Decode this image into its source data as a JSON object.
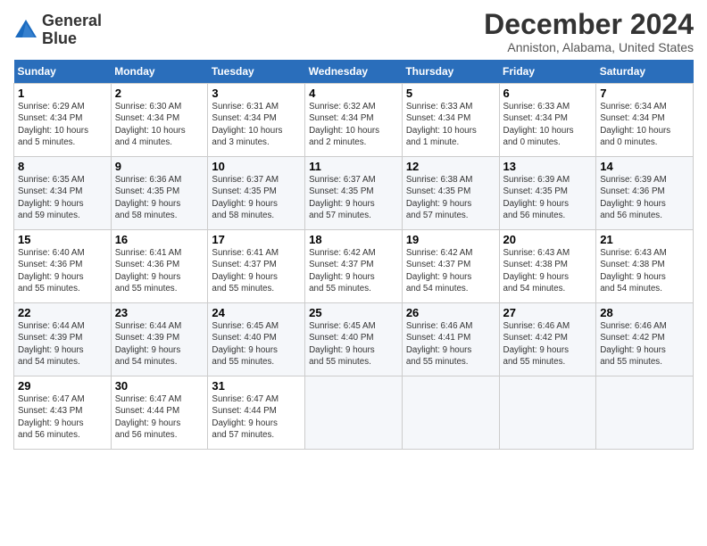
{
  "logo": {
    "line1": "General",
    "line2": "Blue"
  },
  "title": "December 2024",
  "subtitle": "Anniston, Alabama, United States",
  "days_of_week": [
    "Sunday",
    "Monday",
    "Tuesday",
    "Wednesday",
    "Thursday",
    "Friday",
    "Saturday"
  ],
  "weeks": [
    [
      {
        "day": 1,
        "info": "Sunrise: 6:29 AM\nSunset: 4:34 PM\nDaylight: 10 hours\nand 5 minutes."
      },
      {
        "day": 2,
        "info": "Sunrise: 6:30 AM\nSunset: 4:34 PM\nDaylight: 10 hours\nand 4 minutes."
      },
      {
        "day": 3,
        "info": "Sunrise: 6:31 AM\nSunset: 4:34 PM\nDaylight: 10 hours\nand 3 minutes."
      },
      {
        "day": 4,
        "info": "Sunrise: 6:32 AM\nSunset: 4:34 PM\nDaylight: 10 hours\nand 2 minutes."
      },
      {
        "day": 5,
        "info": "Sunrise: 6:33 AM\nSunset: 4:34 PM\nDaylight: 10 hours\nand 1 minute."
      },
      {
        "day": 6,
        "info": "Sunrise: 6:33 AM\nSunset: 4:34 PM\nDaylight: 10 hours\nand 0 minutes."
      },
      {
        "day": 7,
        "info": "Sunrise: 6:34 AM\nSunset: 4:34 PM\nDaylight: 10 hours\nand 0 minutes."
      }
    ],
    [
      {
        "day": 8,
        "info": "Sunrise: 6:35 AM\nSunset: 4:34 PM\nDaylight: 9 hours\nand 59 minutes."
      },
      {
        "day": 9,
        "info": "Sunrise: 6:36 AM\nSunset: 4:35 PM\nDaylight: 9 hours\nand 58 minutes."
      },
      {
        "day": 10,
        "info": "Sunrise: 6:37 AM\nSunset: 4:35 PM\nDaylight: 9 hours\nand 58 minutes."
      },
      {
        "day": 11,
        "info": "Sunrise: 6:37 AM\nSunset: 4:35 PM\nDaylight: 9 hours\nand 57 minutes."
      },
      {
        "day": 12,
        "info": "Sunrise: 6:38 AM\nSunset: 4:35 PM\nDaylight: 9 hours\nand 57 minutes."
      },
      {
        "day": 13,
        "info": "Sunrise: 6:39 AM\nSunset: 4:35 PM\nDaylight: 9 hours\nand 56 minutes."
      },
      {
        "day": 14,
        "info": "Sunrise: 6:39 AM\nSunset: 4:36 PM\nDaylight: 9 hours\nand 56 minutes."
      }
    ],
    [
      {
        "day": 15,
        "info": "Sunrise: 6:40 AM\nSunset: 4:36 PM\nDaylight: 9 hours\nand 55 minutes."
      },
      {
        "day": 16,
        "info": "Sunrise: 6:41 AM\nSunset: 4:36 PM\nDaylight: 9 hours\nand 55 minutes."
      },
      {
        "day": 17,
        "info": "Sunrise: 6:41 AM\nSunset: 4:37 PM\nDaylight: 9 hours\nand 55 minutes."
      },
      {
        "day": 18,
        "info": "Sunrise: 6:42 AM\nSunset: 4:37 PM\nDaylight: 9 hours\nand 55 minutes."
      },
      {
        "day": 19,
        "info": "Sunrise: 6:42 AM\nSunset: 4:37 PM\nDaylight: 9 hours\nand 54 minutes."
      },
      {
        "day": 20,
        "info": "Sunrise: 6:43 AM\nSunset: 4:38 PM\nDaylight: 9 hours\nand 54 minutes."
      },
      {
        "day": 21,
        "info": "Sunrise: 6:43 AM\nSunset: 4:38 PM\nDaylight: 9 hours\nand 54 minutes."
      }
    ],
    [
      {
        "day": 22,
        "info": "Sunrise: 6:44 AM\nSunset: 4:39 PM\nDaylight: 9 hours\nand 54 minutes."
      },
      {
        "day": 23,
        "info": "Sunrise: 6:44 AM\nSunset: 4:39 PM\nDaylight: 9 hours\nand 54 minutes."
      },
      {
        "day": 24,
        "info": "Sunrise: 6:45 AM\nSunset: 4:40 PM\nDaylight: 9 hours\nand 55 minutes."
      },
      {
        "day": 25,
        "info": "Sunrise: 6:45 AM\nSunset: 4:40 PM\nDaylight: 9 hours\nand 55 minutes."
      },
      {
        "day": 26,
        "info": "Sunrise: 6:46 AM\nSunset: 4:41 PM\nDaylight: 9 hours\nand 55 minutes."
      },
      {
        "day": 27,
        "info": "Sunrise: 6:46 AM\nSunset: 4:42 PM\nDaylight: 9 hours\nand 55 minutes."
      },
      {
        "day": 28,
        "info": "Sunrise: 6:46 AM\nSunset: 4:42 PM\nDaylight: 9 hours\nand 55 minutes."
      }
    ],
    [
      {
        "day": 29,
        "info": "Sunrise: 6:47 AM\nSunset: 4:43 PM\nDaylight: 9 hours\nand 56 minutes."
      },
      {
        "day": 30,
        "info": "Sunrise: 6:47 AM\nSunset: 4:44 PM\nDaylight: 9 hours\nand 56 minutes."
      },
      {
        "day": 31,
        "info": "Sunrise: 6:47 AM\nSunset: 4:44 PM\nDaylight: 9 hours\nand 57 minutes."
      },
      null,
      null,
      null,
      null
    ]
  ]
}
